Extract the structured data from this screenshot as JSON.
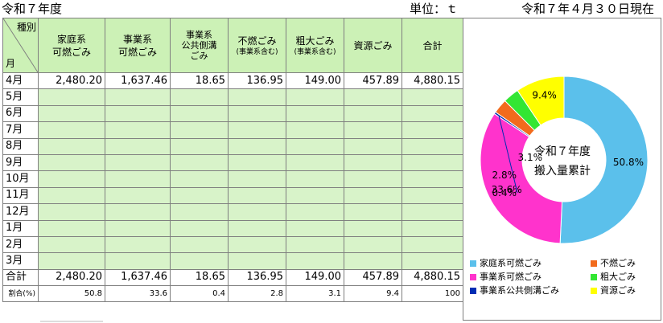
{
  "header": {
    "title": "令和７年度",
    "unit": "単位：ｔ",
    "date": "令和７年４月３０日現在"
  },
  "table": {
    "corner_top": "種別",
    "corner_bottom": "月",
    "columns": [
      {
        "l1": "家庭系",
        "l2": "可燃ごみ"
      },
      {
        "l1": "事業系",
        "l2": "可燃ごみ"
      },
      {
        "l1": "事業系",
        "l2": "公共側溝",
        "l3": "ごみ"
      },
      {
        "l1": "不燃ごみ",
        "sub": "(事業系含む)"
      },
      {
        "l1": "粗大ごみ",
        "sub": "(事業系含む)"
      },
      {
        "l1": "資源ごみ"
      },
      {
        "l1": "合計"
      }
    ],
    "months": [
      "4月",
      "5月",
      "6月",
      "7月",
      "8月",
      "9月",
      "10月",
      "11月",
      "12月",
      "1月",
      "2月",
      "3月"
    ],
    "april": [
      "2,480.20",
      "1,637.46",
      "18.65",
      "136.95",
      "149.00",
      "457.89",
      "4,880.15"
    ],
    "total_label": "合計",
    "totals": [
      "2,480.20",
      "1,637.46",
      "18.65",
      "136.95",
      "149.00",
      "457.89",
      "4,880.15"
    ],
    "ratio_label": "割合(%)",
    "ratios": [
      "50.8",
      "33.6",
      "0.4",
      "2.8",
      "3.1",
      "9.4",
      "100"
    ]
  },
  "chart_data": {
    "type": "pie",
    "center_label_line1": "令和７年度",
    "center_label_line2": "搬入量累計",
    "series": [
      {
        "name": "家庭系可燃ごみ",
        "value": 50.8,
        "label": "50.8%",
        "color": "#5bc0eb"
      },
      {
        "name": "事業系可燃ごみ",
        "value": 33.6,
        "label": "33.6%",
        "color": "#ff33cc"
      },
      {
        "name": "事業系公共側溝ごみ",
        "value": 0.4,
        "label": "0.4%",
        "color": "#002db3"
      },
      {
        "name": "不燃ごみ",
        "value": 2.8,
        "label": "2.8%",
        "color": "#f26b1d"
      },
      {
        "name": "粗大ごみ",
        "value": 3.1,
        "label": "3.1%",
        "color": "#33e633"
      },
      {
        "name": "資源ごみ",
        "value": 9.4,
        "label": "9.4%",
        "color": "#ffff00"
      }
    ],
    "legend_order": [
      "家庭系可燃ごみ",
      "不燃ごみ",
      "事業系可燃ごみ",
      "粗大ごみ",
      "事業系公共側溝ごみ",
      "資源ごみ"
    ],
    "legend_placement": "bottom"
  }
}
